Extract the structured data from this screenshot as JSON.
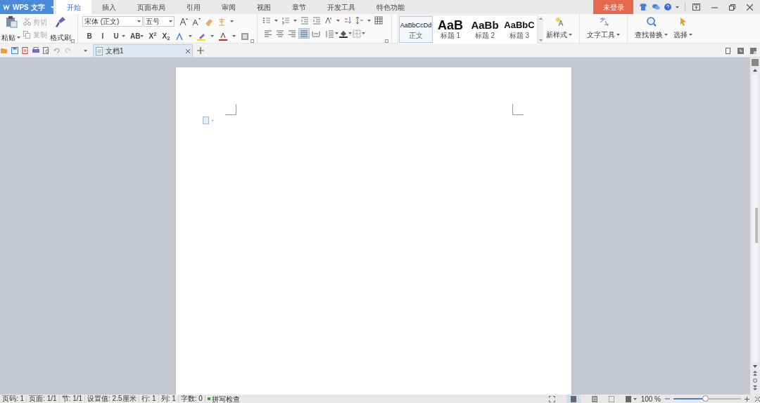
{
  "app_button": {
    "label": "WPS 文字"
  },
  "tabs": [
    {
      "label": "开始",
      "selected": true
    },
    {
      "label": "插入",
      "selected": false
    },
    {
      "label": "页面布局",
      "selected": false
    },
    {
      "label": "引用",
      "selected": false
    },
    {
      "label": "审阅",
      "selected": false
    },
    {
      "label": "视图",
      "selected": false
    },
    {
      "label": "章节",
      "selected": false
    },
    {
      "label": "开发工具",
      "selected": false
    },
    {
      "label": "特色功能",
      "selected": false
    }
  ],
  "login_button": {
    "label": "未登录"
  },
  "clipboard": {
    "paste": "粘贴",
    "format_painter": "格式刷",
    "small": [
      {
        "label": "剪切",
        "disabled": true
      },
      {
        "label": "复制",
        "disabled": true
      }
    ]
  },
  "font": {
    "family": "宋体 (正文)",
    "size": "五号"
  },
  "font_buttons": [
    {
      "label": "B",
      "dropdown": false
    },
    {
      "label": "I",
      "dropdown": false
    },
    {
      "label": "U",
      "dropdown": true
    },
    {
      "label": "AB",
      "dropdown": true
    },
    {
      "label": "X$^{2}$",
      "dropdown": false
    },
    {
      "label": "X$_{2}$",
      "dropdown": false
    }
  ],
  "alignments": [
    {
      "selected": false
    },
    {
      "selected": false
    },
    {
      "selected": false
    },
    {
      "selected": true
    },
    {
      "selected": false
    }
  ],
  "styles": [
    {
      "preview": "AaBbCcDd",
      "name": "正文",
      "selected": true
    },
    {
      "preview": "AaB",
      "name": "标题 1",
      "selected": false
    },
    {
      "preview": "AaBb",
      "name": "标题 2",
      "selected": false
    },
    {
      "preview": "AaBbC",
      "name": "标题 3",
      "selected": false
    }
  ],
  "tools": [
    {
      "label": "新样式"
    },
    {
      "label": "文字工具"
    },
    {
      "label": "查找替换"
    },
    {
      "label": "选择"
    }
  ],
  "document_tab": {
    "title": "文档1"
  },
  "status_bar": {
    "items": [
      "页码: 1",
      "页面: 1/1",
      "节: 1/1",
      "设置值: 2.5厘米",
      "行: 1",
      "列: 1",
      "字数: 0"
    ],
    "spell_check": "拼写检查",
    "zoom": "100 %",
    "level": 0.47
  }
}
